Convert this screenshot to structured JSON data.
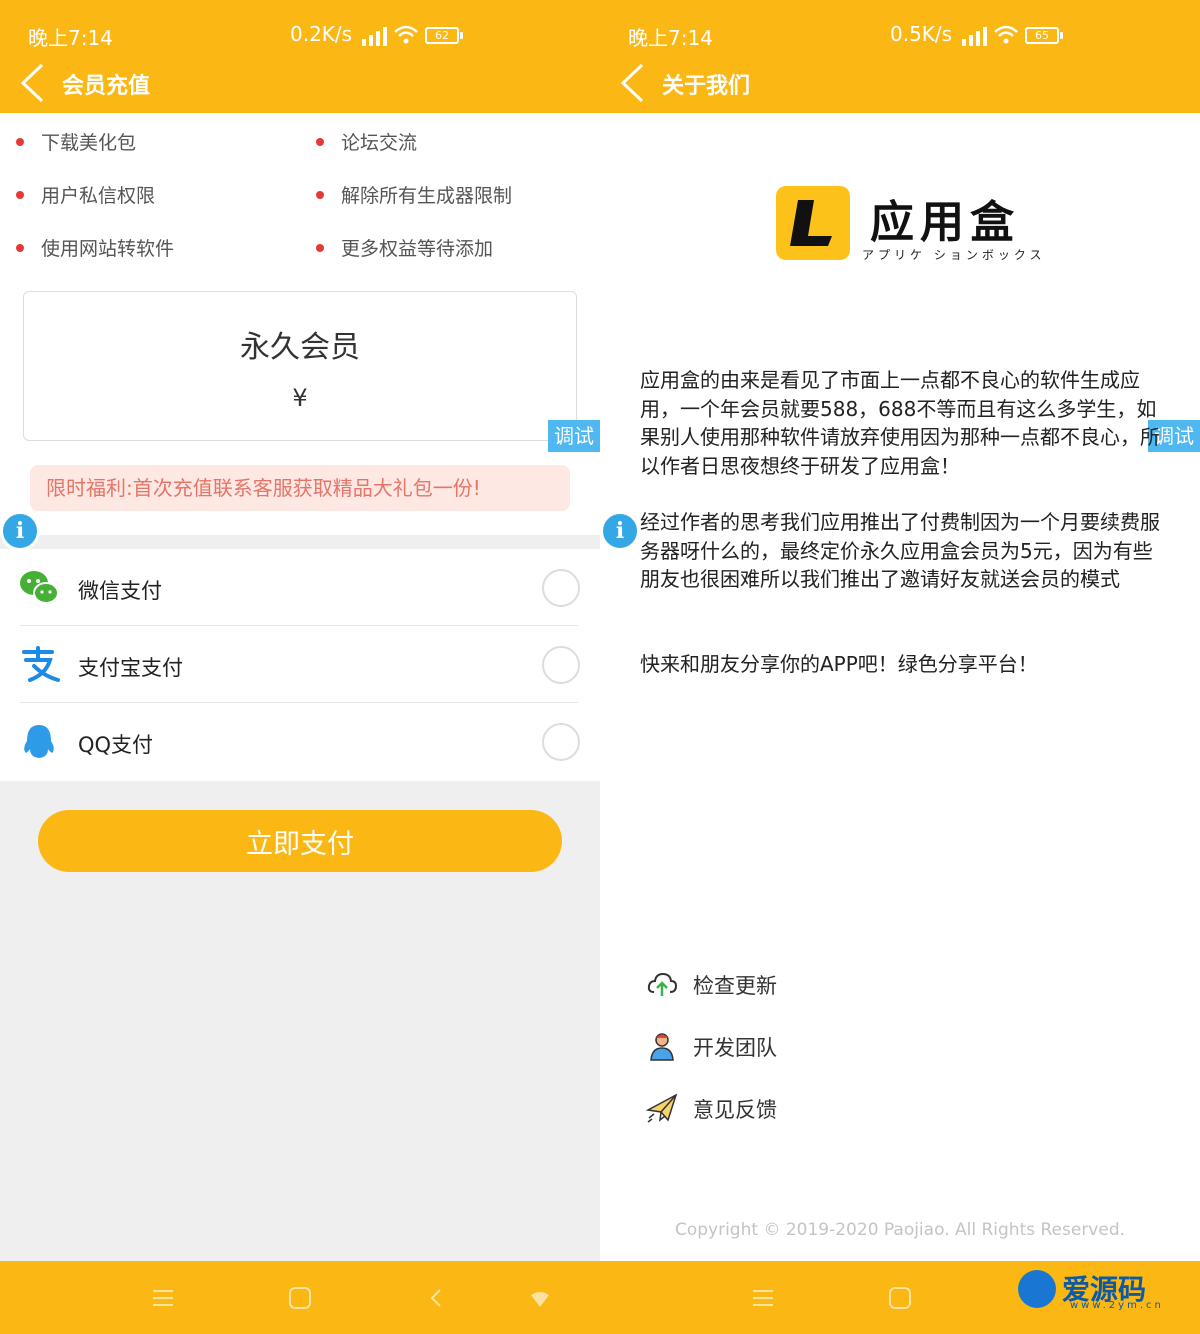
{
  "left": {
    "status": {
      "time": "晚上7:14",
      "speed": "0.2K/s",
      "battery": "62"
    },
    "header": {
      "title": "会员充值"
    },
    "perks": [
      "下载美化包",
      "论坛交流",
      "用户私信权限",
      "解除所有生成器限制",
      "使用网站转软件",
      "更多权益等待添加"
    ],
    "plan": {
      "name": "永久会员",
      "price": "¥"
    },
    "debug_label": "调试",
    "notice": "限时福利:首次充值联系客服获取精品大礼包一份!",
    "payments": [
      {
        "label": "微信支付",
        "icon": "wechat-icon"
      },
      {
        "label": "支付宝支付",
        "icon": "alipay-icon"
      },
      {
        "label": "QQ支付",
        "icon": "qq-icon"
      }
    ],
    "pay_button": "立即支付"
  },
  "right": {
    "status": {
      "time": "晚上7:14",
      "speed": "0.5K/s",
      "battery": "65"
    },
    "header": {
      "title": "关于我们"
    },
    "logo": {
      "name": "应用盒",
      "subtitle": "アプリケ ションボックス",
      "letter": "L"
    },
    "debug_label": "调试",
    "paragraphs": [
      "应用盒的由来是看见了市面上一点都不良心的软件生成应用，一个年会员就要588，688不等而且有这么多学生，如果别人使用那种软件请放弃使用因为那种一点都不良心，所以作者日思夜想终于研发了应用盒！",
      "经过作者的思考我们应用推出了付费制因为一个月要续费服务器呀什么的，最终定价永久应用盒会员为5元，因为有些朋友也很困难所以我们推出了邀请好友就送会员的模式",
      "快来和朋友分享你的APP吧！绿色分享平台！"
    ],
    "menu": [
      {
        "label": "检查更新",
        "icon": "cloud-upload-icon"
      },
      {
        "label": "开发团队",
        "icon": "team-icon"
      },
      {
        "label": "意见反馈",
        "icon": "paper-plane-icon"
      }
    ],
    "copyright": "Copyright © 2019-2020 Paojiao. All Rights Reserved.",
    "watermark": {
      "text": "爱源码",
      "sub": "www.2ym.cn"
    }
  },
  "colors": {
    "accent": "#fbb714",
    "debug": "#4fb8f0",
    "notice_bg": "#fde8e4",
    "notice_text": "#e57568"
  }
}
